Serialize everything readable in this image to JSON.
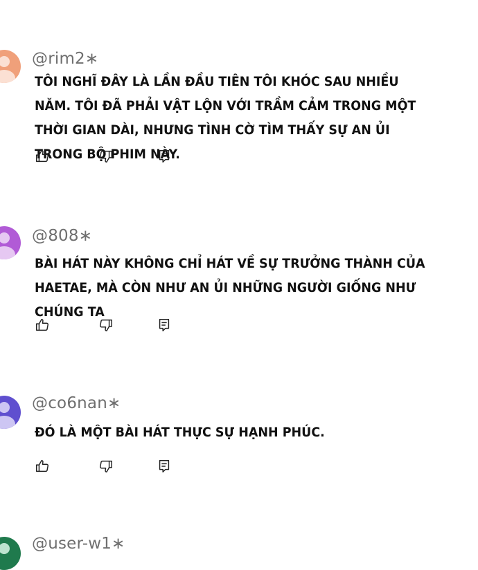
{
  "comments": [
    {
      "username": "@rim2∗",
      "text": "TÔI NGHĨ ĐÂY LÀ LẦN ĐẦU TIÊN TÔI KHÓC SAU NHIỀU NĂM. TÔI ĐÃ PHẢI VẬT LỘN VỚI TRẦM CẢM TRONG MỘT THỜI GIAN DÀI, NHƯNG TÌNH CỜ TÌM THẤY SỰ AN ỦI TRONG BỘ PHIM NÀY.",
      "avatar_color": "#f0a07a",
      "avatar_accent": "#fbe0d3"
    },
    {
      "username": "@808∗",
      "text": "BÀI HÁT NÀY KHÔNG CHỈ HÁT VỀ SỰ TRƯỞNG THÀNH CỦA HAETAE, MÀ CÒN NHƯ AN ỦI NHỮNG NGƯỜI GIỐNG NHƯ CHÚNG TA",
      "avatar_color": "#b15bd6",
      "avatar_accent": "#e6c8f2"
    },
    {
      "username": "@co6nan∗",
      "text": "ĐÓ LÀ MỘT BÀI HÁT THỰC SỰ HẠNH PHÚC.",
      "avatar_color": "#5f4fcf",
      "avatar_accent": "#cdc6f3"
    },
    {
      "username": "@user-w1∗",
      "text": "",
      "avatar_color": "#1f7a4d",
      "avatar_accent": "#bde3cf"
    }
  ],
  "icons": {
    "like": "thumbs-up-icon",
    "dislike": "thumbs-down-icon",
    "reply": "reply-icon"
  }
}
